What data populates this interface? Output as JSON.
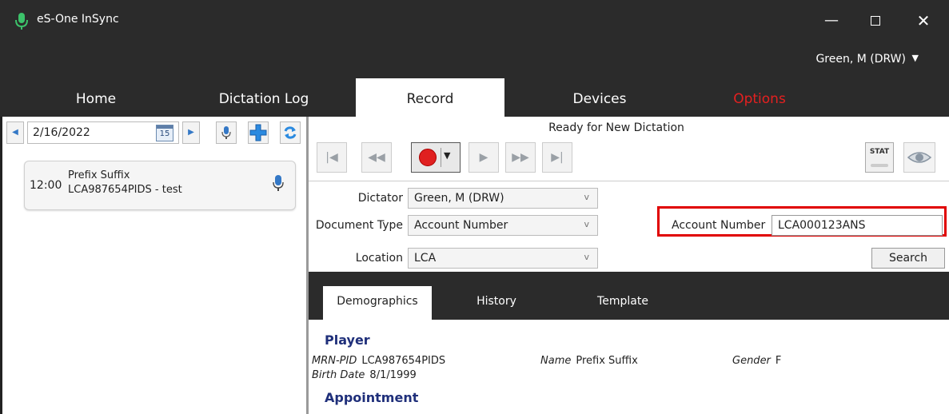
{
  "window": {
    "title": "eS-One InSync",
    "minimize": "—",
    "close": "✕"
  },
  "user": {
    "name": "Green, M (DRW)",
    "caret": "▼"
  },
  "tabs": [
    {
      "label": "Home"
    },
    {
      "label": "Dictation Log"
    },
    {
      "label": "Record"
    },
    {
      "label": "Devices"
    },
    {
      "label": "Options"
    }
  ],
  "left": {
    "date": "2/16/2022",
    "calendar_day": "15",
    "prev": "◀",
    "next": "▶",
    "item": {
      "time": "12:00",
      "name": "Prefix Suffix",
      "subtitle": "LCA987654PIDS - test"
    }
  },
  "record": {
    "status": "Ready for New Dictation",
    "stat_label": "STAT"
  },
  "form": {
    "dictator_label": "Dictator",
    "dictator_value": "Green, M (DRW)",
    "doctype_label": "Document Type",
    "doctype_value": "Account Number",
    "location_label": "Location",
    "location_value": "LCA",
    "chevron": "v",
    "account_label": "Account Number",
    "account_value": "LCA000123ANS",
    "search_label": "Search"
  },
  "lower_tabs": [
    {
      "label": "Demographics"
    },
    {
      "label": "History"
    },
    {
      "label": "Template"
    }
  ],
  "demographics": {
    "player_title": "Player",
    "mrn_label": "MRN-PID",
    "mrn_value": "LCA987654PIDS",
    "name_label": "Name",
    "name_value": "Prefix Suffix",
    "gender_label": "Gender",
    "gender_value": "F",
    "birth_label": "Birth Date",
    "birth_value": "8/1/1999",
    "appointment_title": "Appointment"
  },
  "colors": {
    "dark_bg": "#2b2b2b",
    "options_red": "#e52020",
    "highlight_red": "#e00000",
    "section_blue": "#1f2f7a",
    "accent_blue": "#3478c6"
  }
}
